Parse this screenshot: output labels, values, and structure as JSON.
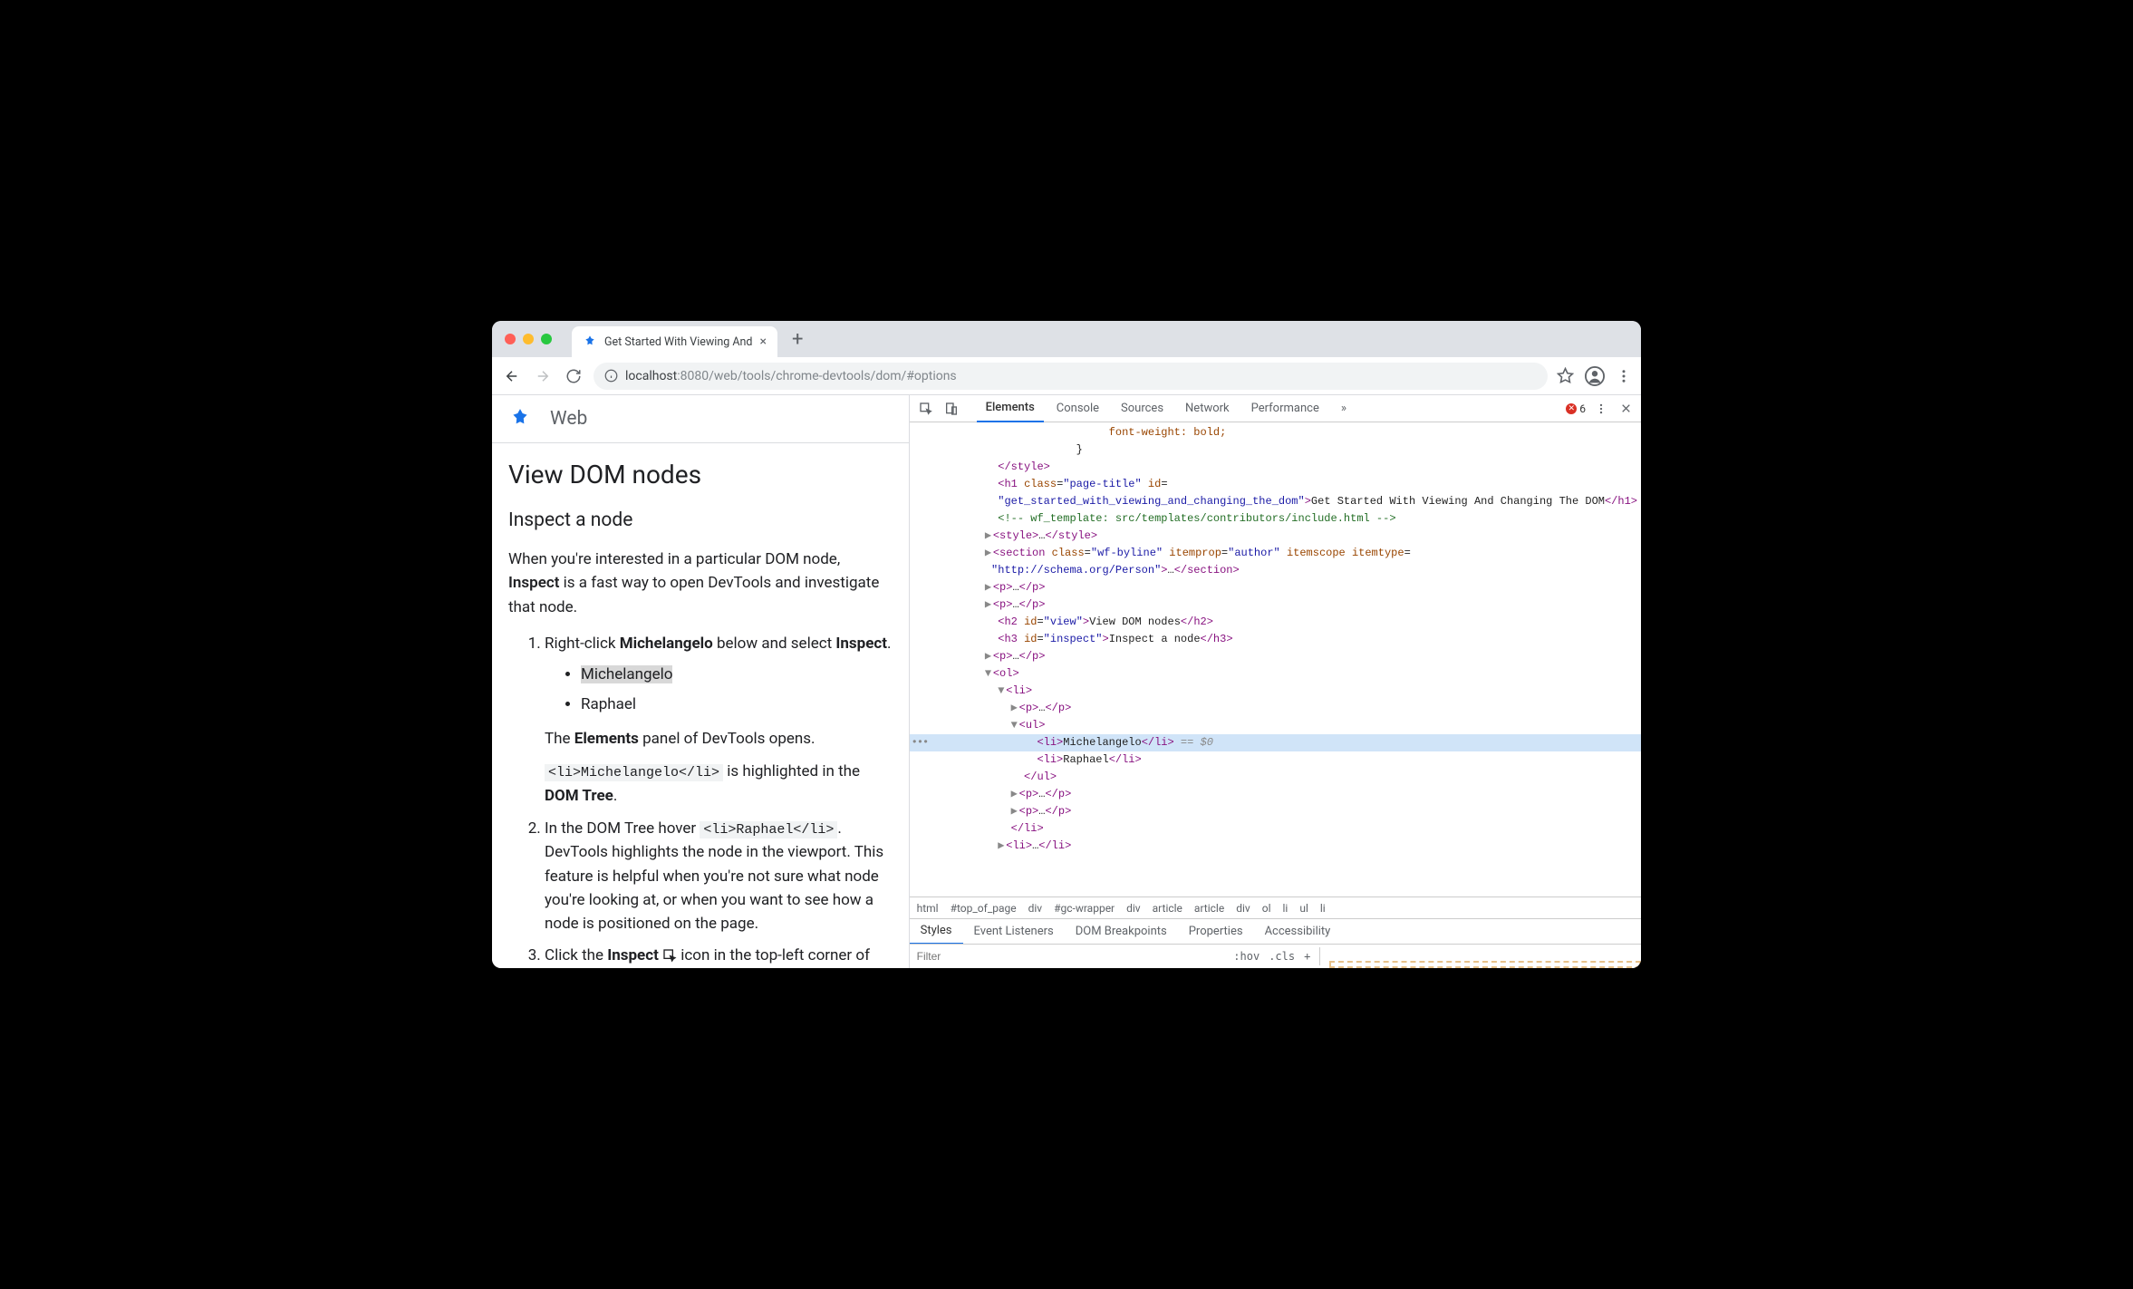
{
  "browser": {
    "tab_title": "Get Started With Viewing And",
    "new_tab_glyph": "+",
    "close_glyph": "×",
    "address": {
      "host": "localhost",
      "port": ":8080",
      "path": "/web/tools/chrome-devtools/dom/#options"
    }
  },
  "page": {
    "site_label": "Web",
    "h1": "View DOM nodes",
    "h2": "Inspect a node",
    "intro_1": "When you're interested in a particular DOM node, ",
    "intro_bold": "Inspect",
    "intro_2": " is a fast way to open DevTools and investigate that node.",
    "step1_a": "Right-click ",
    "step1_bold": "Michelangelo",
    "step1_b": " below and select ",
    "step1_bold2": "Inspect",
    "step1_c": ".",
    "li_michelangelo": "Michelangelo",
    "li_raphael": "Raphael",
    "after1_a": "The ",
    "after1_bold": "Elements",
    "after1_b": " panel of DevTools opens.",
    "after2_code": "<li>Michelangelo</li>",
    "after2_a": " is highlighted in the ",
    "after2_bold": "DOM Tree",
    "after2_b": ".",
    "step2_a": "In the DOM Tree hover ",
    "step2_code": "<li>Raphael</li>",
    "step2_b": ". DevTools highlights the node in the viewport. This feature is helpful when you're not sure what node you're looking at, or when you want to see how a node is positioned on the page.",
    "step3_a": "Click the ",
    "step3_bold": "Inspect",
    "step3_b": " icon in the top-left corner of DevTools"
  },
  "devtools": {
    "tabs": [
      "Elements",
      "Console",
      "Sources",
      "Network",
      "Performance"
    ],
    "more_glyph": "»",
    "error_count": "6",
    "selected_suffix": " == $0",
    "breadcrumb": [
      "html",
      "#top_of_page",
      "div",
      "#gc-wrapper",
      "div",
      "article",
      "article",
      "div",
      "ol",
      "li",
      "ul",
      "li"
    ],
    "subtabs": [
      "Styles",
      "Event Listeners",
      "DOM Breakpoints",
      "Properties",
      "Accessibility"
    ],
    "filter_placeholder": "Filter",
    "hov_label": ":hov",
    "cls_label": ".cls",
    "plus_glyph": "+",
    "tree": {
      "l0": "            font-weight: bold;",
      "l1": "          }",
      "l2_close_style": "</style>",
      "h1_text": "Get Started With Viewing And Changing The DOM",
      "h1_class": "page-title",
      "h1_id": "get_started_with_viewing_and_changing_the_dom",
      "comment": "<!-- wf_template: src/templates/contributors/include.html -->",
      "section_class": "wf-byline",
      "section_itemprop": "author",
      "section_itemtype": "http://schema.org/Person",
      "h2_id": "view",
      "h2_text": "View DOM nodes",
      "h3_id": "inspect",
      "h3_text": "Inspect a node",
      "li1_text": "Michelangelo",
      "li2_text": "Raphael"
    }
  }
}
